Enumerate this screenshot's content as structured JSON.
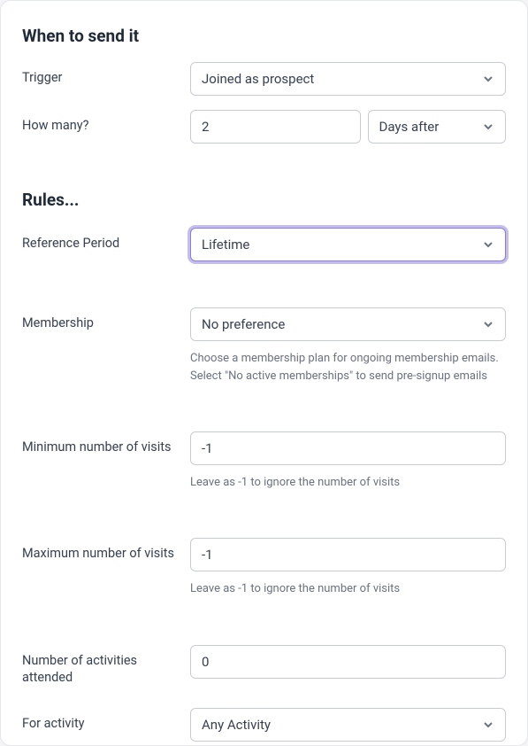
{
  "section1": {
    "title": "When to send it"
  },
  "trigger": {
    "label": "Trigger",
    "value": "Joined as prospect"
  },
  "howMany": {
    "label": "How many?",
    "value": "2",
    "unit": "Days after"
  },
  "section2": {
    "title": "Rules..."
  },
  "referencePeriod": {
    "label": "Reference Period",
    "value": "Lifetime"
  },
  "membership": {
    "label": "Membership",
    "value": "No preference",
    "helper": "Choose a membership plan for ongoing membership emails. Select \"No active memberships\" to send pre-signup emails"
  },
  "minVisits": {
    "label": "Minimum number of visits",
    "value": "-1",
    "helper": "Leave as -1 to ignore the number of visits"
  },
  "maxVisits": {
    "label": "Maximum number of visits",
    "value": "-1",
    "helper": "Leave as -1 to ignore the number of visits"
  },
  "activitiesAttended": {
    "label": "Number of activities attended",
    "value": "0"
  },
  "forActivity": {
    "label": "For activity",
    "value": "Any Activity"
  }
}
